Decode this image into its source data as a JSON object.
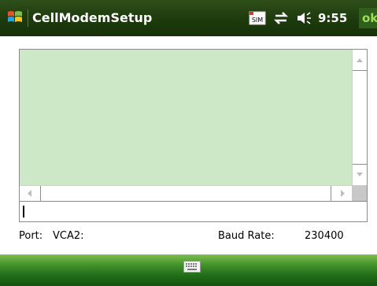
{
  "titlebar": {
    "app_title": "CellModemSetup",
    "time": "9:55",
    "ok_label": "ok",
    "icons": [
      "windows-start-flag-icon",
      "sim-icon",
      "connectivity-icon",
      "volume-icon"
    ]
  },
  "output": {
    "background_color": "#cde8c6",
    "text": ""
  },
  "command": {
    "value": ""
  },
  "status": {
    "port_label": "Port:",
    "port_value": "VCA2:",
    "baud_label": "Baud Rate:",
    "baud_value": "230400"
  },
  "menubar": {
    "icon": "keyboard-icon"
  }
}
